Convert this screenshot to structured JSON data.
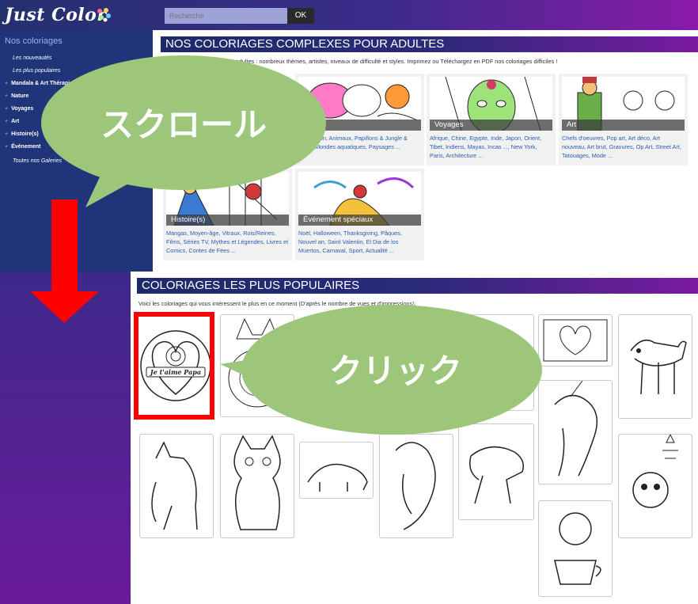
{
  "header": {
    "logo": "Just Color",
    "search_placeholder": "Recherche",
    "ok_label": "OK"
  },
  "sidebar": {
    "title": "Nos coloriages",
    "items": [
      "Les nouveautés",
      "Les plus populaires"
    ],
    "categories": [
      "Mandala & Art Thérapie",
      "Nature",
      "Voyages",
      "Art",
      "Histoire(s)",
      "Événement"
    ],
    "all_galleries": "Toutes nos Galeries"
  },
  "adult_section": {
    "heading": "NOS COLORIAGES COMPLEXES POUR ADULTES",
    "intro": "Nos coloriages gratuits pour adultes : nombreux thèmes, artistes, niveaux de difficulté et styles. Imprimez ou Téléchargez en PDF nos coloriages difficiles !",
    "cards": [
      {
        "caption": "Nature",
        "links": "Végétation, Animaux, Papillons & Jungle & Forêt, Mondes aquatiques, Paysages ..."
      },
      {
        "caption": "Voyages",
        "links": "Afrique, Chine, Egypte, Inde, Japon, Orient, Tibet, Indiens, Mayas, Incas ..., New York, Paris, Architecture ..."
      },
      {
        "caption": "Art",
        "links": "Chefs d'oeuvres, Pop art, Art déco, Art nouveau, Art brut, Gravures, Op Art, Street Art, Tatouages, Mode ..."
      },
      {
        "caption": "Histoire(s)",
        "links": "Mangas, Moyen-âge, Vitraux, Rois/Reines, Films, Séries TV, Mythes et Légendes, Livres et Comics, Contes de Fées ..."
      },
      {
        "caption": "Événement spéciaux",
        "links": "Noël, Halloween, Thanksgiving, Pâques, Nouvel an, Saint Valentin, El Dia de los Muertos, Carnaval, Sport, Actualité ..."
      }
    ]
  },
  "popular_section": {
    "heading": "COLORIAGES LES PLUS POPULAIRES",
    "intro": "Voici les coloriages qui vous intéressent le plus en ce moment (D'après le nombre de vues et d'impressions).",
    "first_item_text": "Je t'aime Papa"
  },
  "annotations": {
    "scroll_label": "スクロール",
    "click_label": "クリック",
    "colors": {
      "bubble": "#9dc67a",
      "arrow": "#ff0000",
      "highlight": "#ff0000"
    }
  }
}
